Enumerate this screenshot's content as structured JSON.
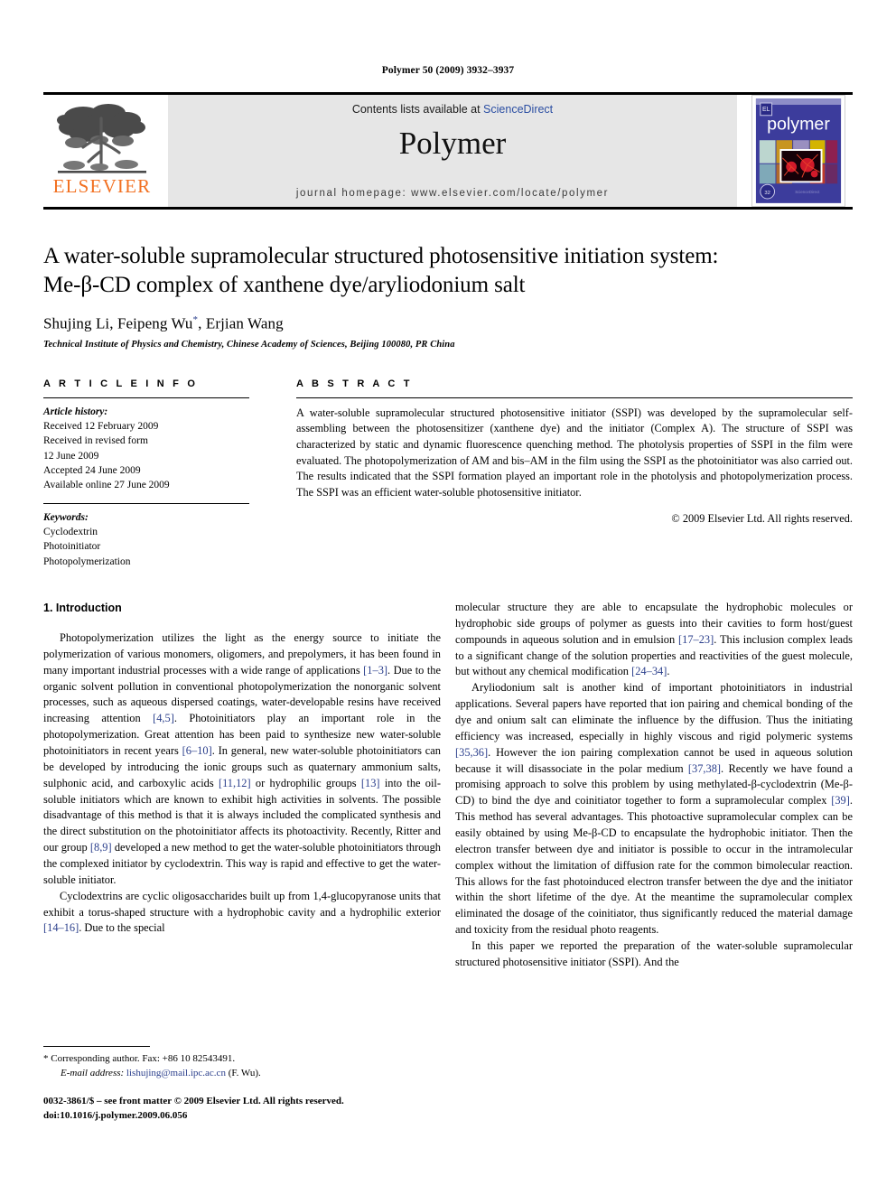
{
  "running_head": "Polymer 50 (2009) 3932–3937",
  "masthead": {
    "contents_prefix": "Contents lists available at ",
    "sciencedirect": "ScienceDirect",
    "journal_name": "Polymer",
    "homepage": "journal homepage: www.elsevier.com/locate/polymer",
    "publisher_name": "ELSEVIER",
    "publisher_color": "#F27021",
    "link_color": "#2b4ea2",
    "cover_title": "polymer",
    "cover_bg": "#3c3c9c"
  },
  "article": {
    "title_line1": "A water-soluble supramolecular structured photosensitive initiation system:",
    "title_line2": "Me-β-CD complex of xanthene dye/aryliodonium salt",
    "authors": "Shujing Li, Feipeng Wu",
    "author_marker": "*",
    "authors_tail": ", Erjian Wang",
    "affiliation": "Technical Institute of Physics and Chemistry, Chinese Academy of Sciences, Beijing 100080, PR China"
  },
  "article_info": {
    "heading": "A R T I C L E   I N F O",
    "history_label": "Article history:",
    "history": [
      "Received 12 February 2009",
      "Received in revised form",
      "12 June 2009",
      "Accepted 24 June 2009",
      "Available online 27 June 2009"
    ],
    "keywords_label": "Keywords:",
    "keywords": [
      "Cyclodextrin",
      "Photoinitiator",
      "Photopolymerization"
    ]
  },
  "abstract": {
    "heading": "A B S T R A C T",
    "text": "A water-soluble supramolecular structured photosensitive initiator (SSPI) was developed by the supramolecular self-assembling between the photosensitizer (xanthene dye) and the initiator (Complex A). The structure of SSPI was characterized by static and dynamic fluorescence quenching method. The photolysis properties of SSPI in the film were evaluated. The photopolymerization of AM and bis–AM in the film using the SSPI as the photoinitiator was also carried out. The results indicated that the SSPI formation played an important role in the photolysis and photopolymerization process. The SSPI was an efficient water-soluble photosensitive initiator.",
    "copyright": "© 2009 Elsevier Ltd. All rights reserved."
  },
  "body": {
    "section_number_title": "1. Introduction",
    "left_paragraphs": [
      {
        "indent": true,
        "parts": [
          {
            "t": "Photopolymerization utilizes the light as the energy source to initiate the polymerization of various monomers, oligomers, and prepolymers, it has been found in many important industrial processes with a wide range of applications "
          },
          {
            "t": "[1–3]",
            "ref": true
          },
          {
            "t": ". Due to the organic solvent pollution in conventional photopolymerization the nonorganic solvent processes, such as aqueous dispersed coatings, water-developable resins have received increasing attention "
          },
          {
            "t": "[4,5]",
            "ref": true
          },
          {
            "t": ". Photoinitiators play an important role in the photopolymerization. Great attention has been paid to synthesize new water-soluble photoinitiators in recent years "
          },
          {
            "t": "[6–10]",
            "ref": true
          },
          {
            "t": ". In general, new water-soluble photoinitiators can be developed by introducing the ionic groups such as quaternary ammonium salts, sulphonic acid, and carboxylic acids "
          },
          {
            "t": "[11,12]",
            "ref": true
          },
          {
            "t": " or hydrophilic groups "
          },
          {
            "t": "[13]",
            "ref": true
          },
          {
            "t": " into the oil-soluble initiators which are known to exhibit high activities in solvents. The possible disadvantage of this method is that it is always included the complicated synthesis and the direct substitution on the photoinitiator affects its photoactivity. Recently, Ritter and our group "
          },
          {
            "t": "[8,9]",
            "ref": true
          },
          {
            "t": " developed a new method to get the water-soluble photoinitiators through the complexed initiator by cyclodextrin. This way is rapid and effective to get the water-soluble initiator."
          }
        ]
      },
      {
        "indent": true,
        "parts": [
          {
            "t": "Cyclodextrins are cyclic oligosaccharides built up from 1,4-glucopyranose units that exhibit a torus-shaped structure with a hydrophobic cavity and a hydrophilic exterior "
          },
          {
            "t": "[14–16]",
            "ref": true
          },
          {
            "t": ". Due to the special"
          }
        ]
      }
    ],
    "right_paragraphs": [
      {
        "indent": false,
        "parts": [
          {
            "t": "molecular structure they are able to encapsulate the hydrophobic molecules or hydrophobic side groups of polymer as guests into their cavities to form host/guest compounds in aqueous solution and in emulsion "
          },
          {
            "t": "[17–23]",
            "ref": true
          },
          {
            "t": ". This inclusion complex leads to a significant change of the solution properties and reactivities of the guest molecule, but without any chemical modification "
          },
          {
            "t": "[24–34]",
            "ref": true
          },
          {
            "t": "."
          }
        ]
      },
      {
        "indent": true,
        "parts": [
          {
            "t": "Aryliodonium salt is another kind of important photoinitiators in industrial applications. Several papers have reported that ion pairing and chemical bonding of the dye and onium salt can eliminate the influence by the diffusion. Thus the initiating efficiency was increased, especially in highly viscous and rigid polymeric systems "
          },
          {
            "t": "[35,36]",
            "ref": true
          },
          {
            "t": ". However the ion pairing complexation cannot be used in aqueous solution because it will disassociate in the polar medium "
          },
          {
            "t": "[37,38]",
            "ref": true
          },
          {
            "t": ". Recently we have found a promising approach to solve this problem by using methylated-β-cyclodextrin (Me-β-CD) to bind the dye and coinitiator together to form a supramolecular complex "
          },
          {
            "t": "[39]",
            "ref": true
          },
          {
            "t": ". This method has several advantages. This photoactive supramolecular complex can be easily obtained by using Me-β-CD to encapsulate the hydrophobic initiator. Then the electron transfer between dye and initiator is possible to occur in the intramolecular complex without the limitation of diffusion rate for the common bimolecular reaction. This allows for the fast photoinduced electron transfer between the dye and the initiator within the short lifetime of the dye. At the meantime the supramolecular complex eliminated the dosage of the coinitiator, thus significantly reduced the material damage and toxicity from the residual photo reagents."
          }
        ]
      },
      {
        "indent": true,
        "parts": [
          {
            "t": "In this paper we reported the preparation of the water-soluble supramolecular structured photosensitive initiator (SSPI). And the"
          }
        ]
      }
    ]
  },
  "footnote": {
    "corresponding": "* Corresponding author. Fax: +86 10 82543491.",
    "email_label": "E-mail address:",
    "email": "lishujing@mail.ipc.ac.cn",
    "email_suffix": "(F. Wu)."
  },
  "footer": {
    "line1": "0032-3861/$ – see front matter © 2009 Elsevier Ltd. All rights reserved.",
    "line2": "doi:10.1016/j.polymer.2009.06.056"
  }
}
